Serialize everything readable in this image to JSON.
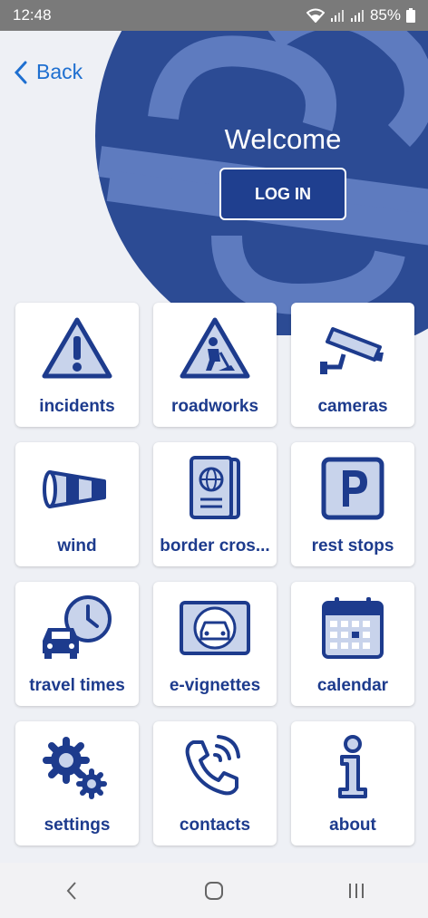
{
  "status_bar": {
    "time": "12:48",
    "battery": "85%"
  },
  "header": {
    "back_label": "Back",
    "welcome": "Welcome",
    "login_label": "LOG IN"
  },
  "tiles": [
    {
      "label": "incidents",
      "icon": "warning-icon"
    },
    {
      "label": "roadworks",
      "icon": "roadworks-icon"
    },
    {
      "label": "cameras",
      "icon": "camera-icon"
    },
    {
      "label": "wind",
      "icon": "windsock-icon"
    },
    {
      "label": "border cros...",
      "icon": "passport-icon"
    },
    {
      "label": "rest stops",
      "icon": "parking-icon"
    },
    {
      "label": "travel times",
      "icon": "car-clock-icon"
    },
    {
      "label": "e-vignettes",
      "icon": "vignette-icon"
    },
    {
      "label": "calendar",
      "icon": "calendar-icon"
    },
    {
      "label": "settings",
      "icon": "gears-icon"
    },
    {
      "label": "contacts",
      "icon": "phone-icon"
    },
    {
      "label": "about",
      "icon": "info-icon"
    }
  ],
  "colors": {
    "primary": "#1d3b8d",
    "hero_circle": "#2c4b94",
    "accent_link": "#1e6fd0",
    "icon_fill": "#c8d3eb"
  }
}
